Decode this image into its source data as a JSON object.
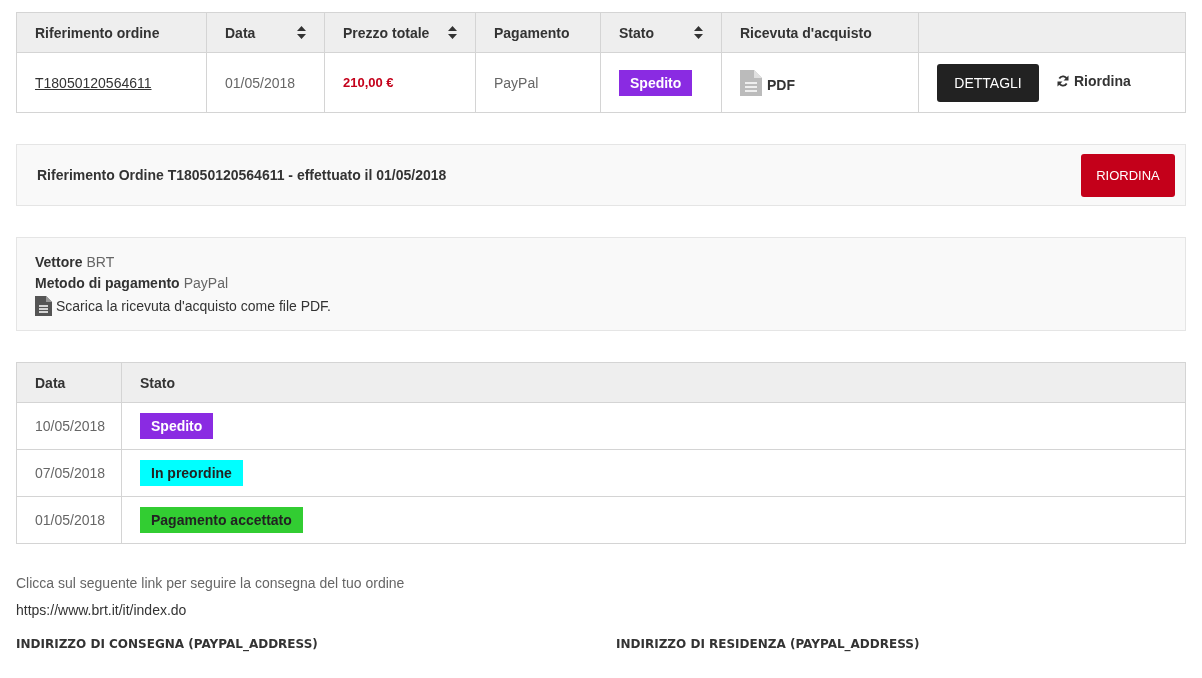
{
  "orders_table": {
    "columns": [
      {
        "label": "Riferimento ordine",
        "sortable": false
      },
      {
        "label": "Data",
        "sortable": true
      },
      {
        "label": "Prezzo totale",
        "sortable": true
      },
      {
        "label": "Pagamento",
        "sortable": false
      },
      {
        "label": "Stato",
        "sortable": true
      },
      {
        "label": "Ricevuta d'acquisto",
        "sortable": false
      }
    ],
    "rows": [
      {
        "reference": "T18050120564611",
        "date": "01/05/2018",
        "total": "210,00 €",
        "payment": "PayPal",
        "status": {
          "label": "Spedito",
          "color": "#8a2be2"
        },
        "receipt": "PDF",
        "details_button": "DETTAGLI",
        "reorder_link": "Riordina"
      }
    ]
  },
  "order_header": {
    "title": "Riferimento Ordine T18050120564611 - effettuato il 01/05/2018",
    "reorder_button": "RIORDINA"
  },
  "order_info": {
    "carrier_label": "Vettore",
    "carrier": "BRT",
    "payment_label": "Metodo di pagamento",
    "payment": "PayPal",
    "receipt_link": "Scarica la ricevuta d'acquisto come file PDF."
  },
  "history_table": {
    "columns": [
      "Data",
      "Stato"
    ],
    "rows": [
      {
        "date": "10/05/2018",
        "status": "Spedito",
        "color": "#8a2be2"
      },
      {
        "date": "07/05/2018",
        "status": "In preordine",
        "color": "#00ffff"
      },
      {
        "date": "01/05/2018",
        "status": "Pagamento accettato",
        "color": "#32cd32"
      }
    ]
  },
  "tracking": {
    "text": "Clicca sul seguente link per seguire la consegna del tuo ordine",
    "link": "https://www.brt.it/it/index.do"
  },
  "addresses": {
    "delivery_heading": "INDIRIZZO DI CONSEGNA (PAYPAL_ADDRESS)",
    "residence_heading": "INDIRIZZO DI RESIDENZA (PAYPAL_ADDRESS)"
  }
}
